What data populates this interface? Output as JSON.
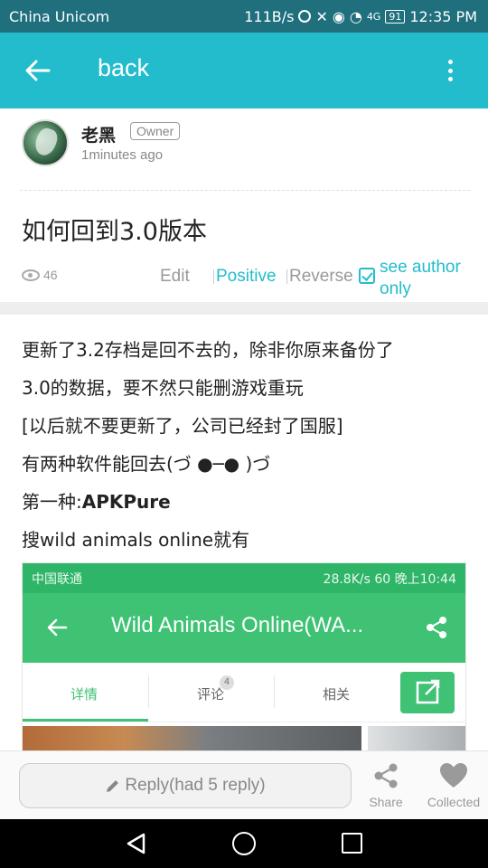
{
  "status_bar": {
    "carrier": "China Unicom",
    "net_speed": "111B/s",
    "signal_type": "4G",
    "battery": "91",
    "time": "12:35 PM"
  },
  "app_bar": {
    "back_label": "back",
    "icons": [
      "arrow-left-icon",
      "more-vert-icon"
    ]
  },
  "post": {
    "author_name": "老黑",
    "author_badge": "Owner",
    "time_ago": "1minutes ago",
    "title": "如何回到3.0版本",
    "views": "46",
    "actions": {
      "edit": "Edit",
      "positive": "Positive",
      "reverse": "Reverse",
      "author_only": "see author only",
      "author_only_checked": true
    },
    "content": [
      "更新了3.2存档是回不去的，除非你原来备份了",
      "3.0的数据，要不然只能删游戏重玩",
      "[以后就不要更新了，公司已经封了国服]",
      "有两种软件能回去(づ ●─● )づ",
      "第一种:",
      "APKPure",
      "搜wild animals online就有"
    ]
  },
  "embedded_screenshot": {
    "status_left": "中国联通",
    "net_speed": "28.8K/s",
    "battery": "60",
    "time": "晚上10:44",
    "title": "Wild Animals Online(WA...",
    "tabs": [
      "详情",
      "评论",
      "相关"
    ],
    "comment_count": "4",
    "accent_color": "#3fc274"
  },
  "bottom_bar": {
    "reply_label": "Reply(had 5 reply)",
    "share_label": "Share",
    "collected_label": "Collected"
  },
  "colors": {
    "primary": "#23bccc",
    "status_bar": "#1f6f7d"
  }
}
